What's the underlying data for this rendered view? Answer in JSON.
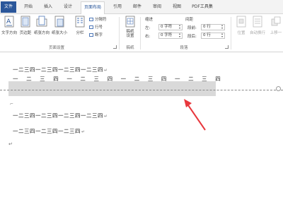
{
  "tabs": {
    "file": "文件",
    "items": [
      "开始",
      "插入",
      "设计",
      "页面布局",
      "引用",
      "邮件",
      "审阅",
      "视图",
      "PDF工具集"
    ],
    "active_index": 3
  },
  "ribbon": {
    "page_setup": {
      "text_direction": "文字方向",
      "margins": "页边距",
      "orientation": "纸张方向",
      "size": "纸张大小",
      "columns": "分栏",
      "breaks": "分隔符",
      "line_numbers": "行号",
      "hyphenation": "断字",
      "group_label": "页面设置"
    },
    "draft": {
      "button": "稿纸设置",
      "group_label": "稿纸"
    },
    "paragraph": {
      "indent_header": "缩进",
      "spacing_header": "间距",
      "indent_left_label": "左:",
      "indent_left_value": "0 字符",
      "indent_right_label": "右:",
      "indent_right_value": "0 字符",
      "spacing_before_label": "段前:",
      "spacing_before_value": "0 行",
      "spacing_after_label": "段后:",
      "spacing_after_value": "0 行",
      "group_label": "段落"
    },
    "arrange": {
      "position": "位置",
      "wrap_text": "自动换行",
      "bring_forward": "上移一"
    }
  },
  "document": {
    "line1": "一二三四一二三四一二三四一二三四",
    "line2": "一 二 三 四 一 二 三 四 一 二 三 四 一 二 三 四",
    "line3": "一二三四一二三四一二三四一二三四",
    "line4": "一二三四一二三四一二三四",
    "pilcrow": "↵"
  },
  "colors": {
    "accent": "#2b579a",
    "arrow": "#e8383d",
    "highlight": "#d9d9d9"
  }
}
